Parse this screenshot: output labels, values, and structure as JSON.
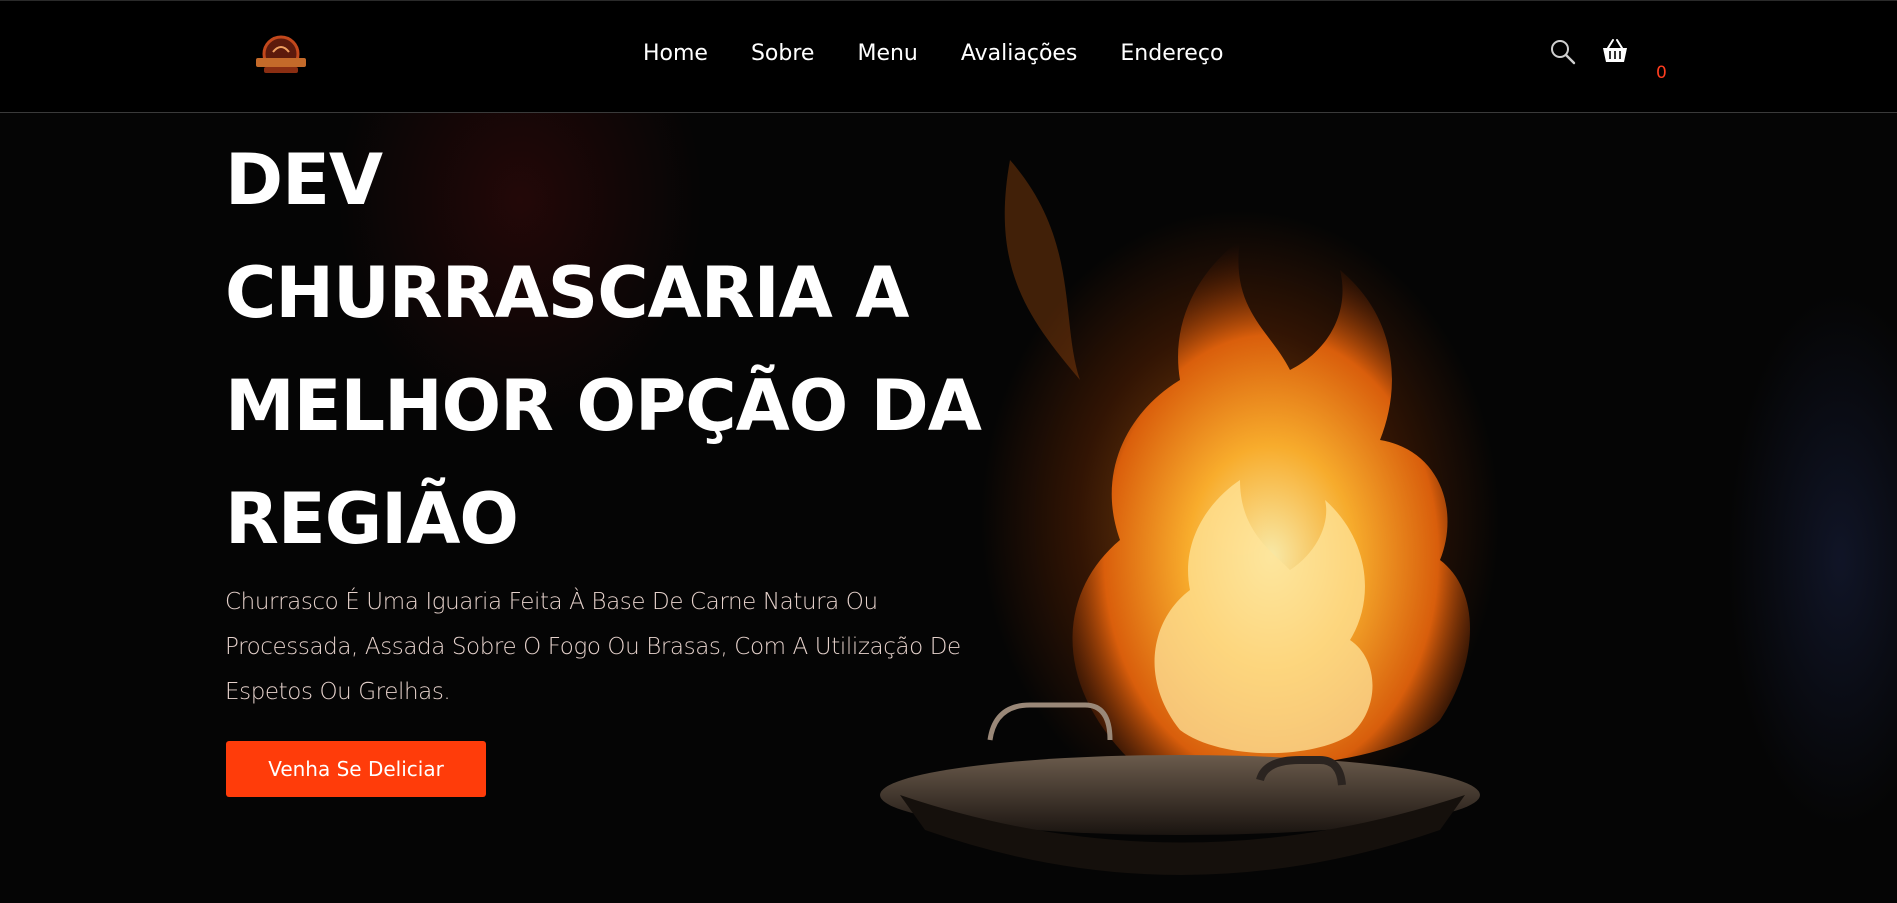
{
  "header": {
    "logo_icon": "restaurant-logo",
    "nav": [
      {
        "label": "Home"
      },
      {
        "label": "Sobre"
      },
      {
        "label": "Menu"
      },
      {
        "label": "Avaliações"
      },
      {
        "label": "Endereço"
      }
    ],
    "search_icon": "search-icon",
    "cart_icon": "basket-icon",
    "cart_count": "0"
  },
  "hero": {
    "title": "DEV CHURRASCARIA A MELHOR OPÇÃO DA REGIÃO",
    "description": "Churrasco É Uma Iguaria Feita À Base De Carne Natura Ou Processada, Assada Sobre O Fogo Ou Brasas, Com A Utilização De Espetos Ou Grelhas.",
    "button_label": "Venha Se Deliciar"
  },
  "colors": {
    "accent": "#ff3c0a",
    "cart_count": "#ff3d1f",
    "background": "#000000"
  }
}
